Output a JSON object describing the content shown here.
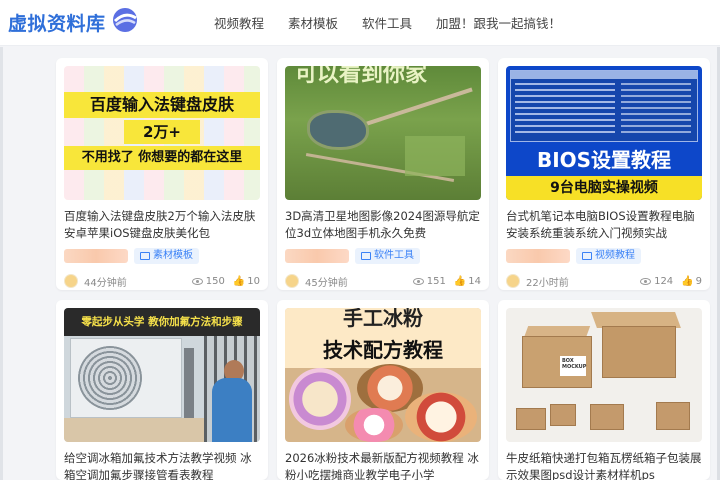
{
  "header": {
    "logo_text": "虚拟资料库",
    "nav": [
      "视频教程",
      "素材模板",
      "软件工具",
      "加盟！跟我一起搞钱！"
    ]
  },
  "cards": [
    {
      "thumb_text": {
        "line1": "百度输入法键盘皮肤",
        "line2": "2万+",
        "line3": "不用找了 你想要的都在这里"
      },
      "title": "百度输入法键盘皮肤2万个输入法皮肤安卓苹果iOS键盘皮肤美化包",
      "tag": "素材模板",
      "time": "44分钟前",
      "views": "150",
      "likes": "10"
    },
    {
      "thumb_text": {
        "line1": "可以看到你家"
      },
      "title": "3D高清卫星地图影像2024图源导航定位3d立体地图手机永久免费",
      "tag": "软件工具",
      "time": "45分钟前",
      "views": "151",
      "likes": "14"
    },
    {
      "thumb_text": {
        "line1": "BIOS设置教程",
        "line2": "9台电脑实操视频"
      },
      "title": "台式机笔记本电脑BIOS设置教程电脑安装系统重装系统入门视频实战",
      "tag": "视频教程",
      "time": "22小时前",
      "views": "124",
      "likes": "9"
    },
    {
      "thumb_text": {
        "line1": "零起步从头学 教你加氟方法和步骤"
      },
      "title": "给空调冰箱加氟技术方法教学视频 冰箱空调加氟步骤接管看表教程"
    },
    {
      "thumb_text": {
        "line1": "手工冰粉",
        "line2": "技术配方教程"
      },
      "title": "2026冰粉技术最新版配方视频教程 冰粉小吃摆摊商业教学电子小学"
    },
    {
      "thumb_text": {
        "line1": "BOX MOCKUP"
      },
      "title": "牛皮纸箱快递打包箱瓦楞纸箱子包装展示效果图psd设计素材样机ps"
    }
  ],
  "colors": {
    "brand": "#2f6fd9",
    "tag_bg": "#eaf2fd",
    "tag_text": "#3b82f6"
  }
}
